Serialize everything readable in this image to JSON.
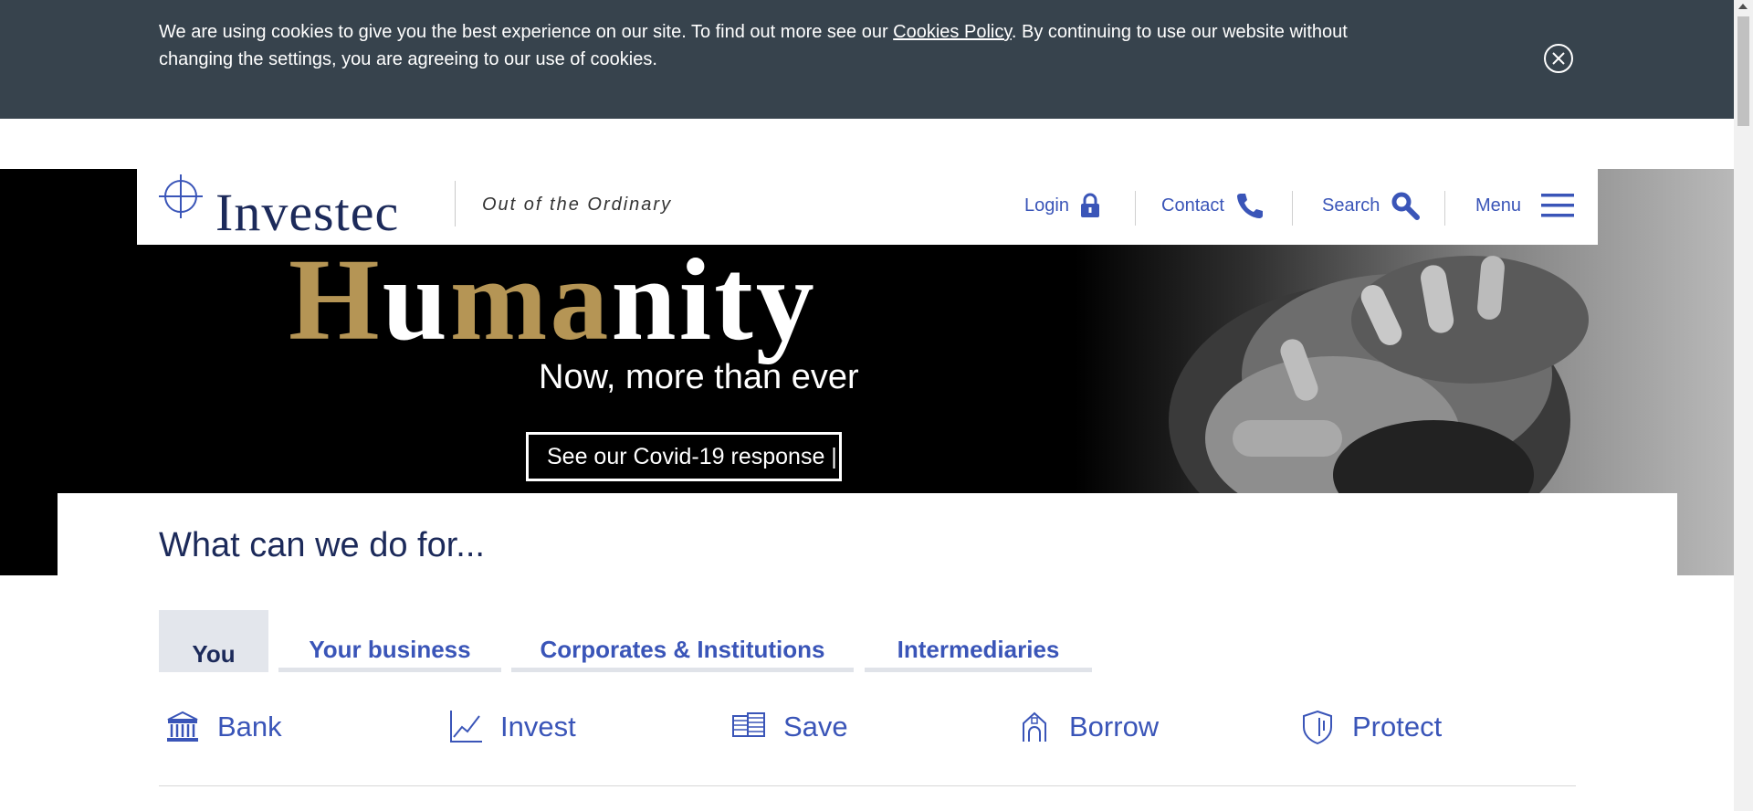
{
  "cookie_banner": {
    "text_before": "We are using cookies to give you the best experience on our site. To find out more see our ",
    "link": "Cookies Policy",
    "text_after": ". By continuing to use our website without changing the settings, you are agreeing to our use of cookies.",
    "close_icon": "close-circle-icon"
  },
  "header": {
    "logo_text": "Investec",
    "tagline": "Out of the Ordinary",
    "nav": {
      "login": "Login",
      "contact": "Contact",
      "search": "Search",
      "menu": "Menu"
    }
  },
  "hero": {
    "headline_gold_1": "H",
    "headline_white_1": "u",
    "headline_gold_2": "ma",
    "headline_white_2": "nity",
    "subheadline": "Now, more than ever",
    "cta": "See our Covid-19 response |"
  },
  "main": {
    "heading": "What can we do for...",
    "tabs": [
      {
        "label": "You",
        "active": true
      },
      {
        "label": "Your business",
        "active": false
      },
      {
        "label": "Corporates & Institutions",
        "active": false
      },
      {
        "label": "Intermediaries",
        "active": false
      }
    ],
    "products": [
      {
        "label": "Bank",
        "icon": "bank-icon"
      },
      {
        "label": "Invest",
        "icon": "chart-line-icon"
      },
      {
        "label": "Save",
        "icon": "coins-icon"
      },
      {
        "label": "Borrow",
        "icon": "house-icon"
      },
      {
        "label": "Protect",
        "icon": "shield-icon"
      }
    ]
  },
  "colors": {
    "brand_navy": "#1c2a5a",
    "link_blue": "#3a55b8",
    "gold": "#b59555",
    "cookie_bg": "#37434d"
  }
}
